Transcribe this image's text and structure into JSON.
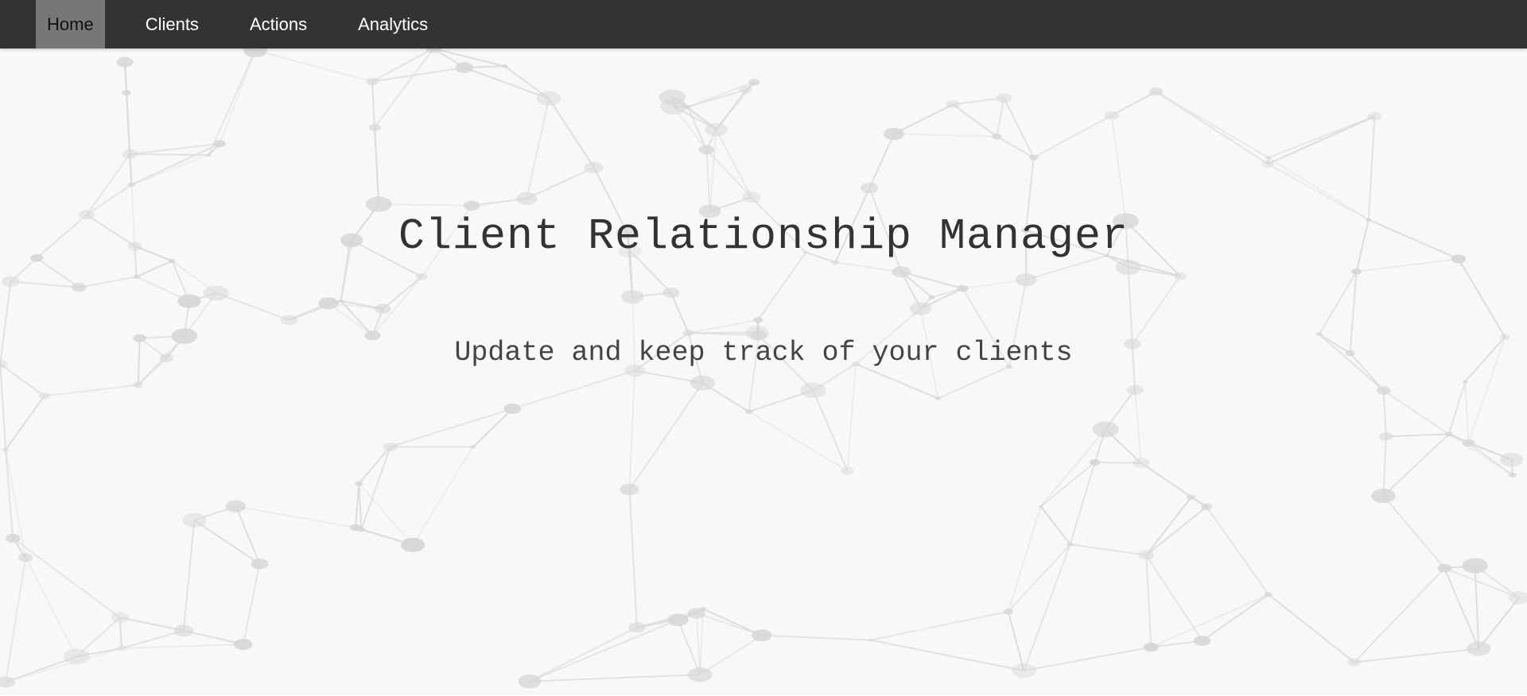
{
  "navbar": {
    "items": [
      {
        "label": "Home",
        "active": true
      },
      {
        "label": "Clients",
        "active": false
      },
      {
        "label": "Actions",
        "active": false
      },
      {
        "label": "Analytics",
        "active": false
      }
    ]
  },
  "hero": {
    "title": "Client Relationship Manager",
    "subtitle": "Update and keep track of your clients",
    "background_icon": "network-graph-pattern"
  },
  "colors": {
    "navbar_bg": "#333333",
    "nav_active_bg": "#777777",
    "hero_bg": "#f8f8f8",
    "text": "#333333"
  }
}
